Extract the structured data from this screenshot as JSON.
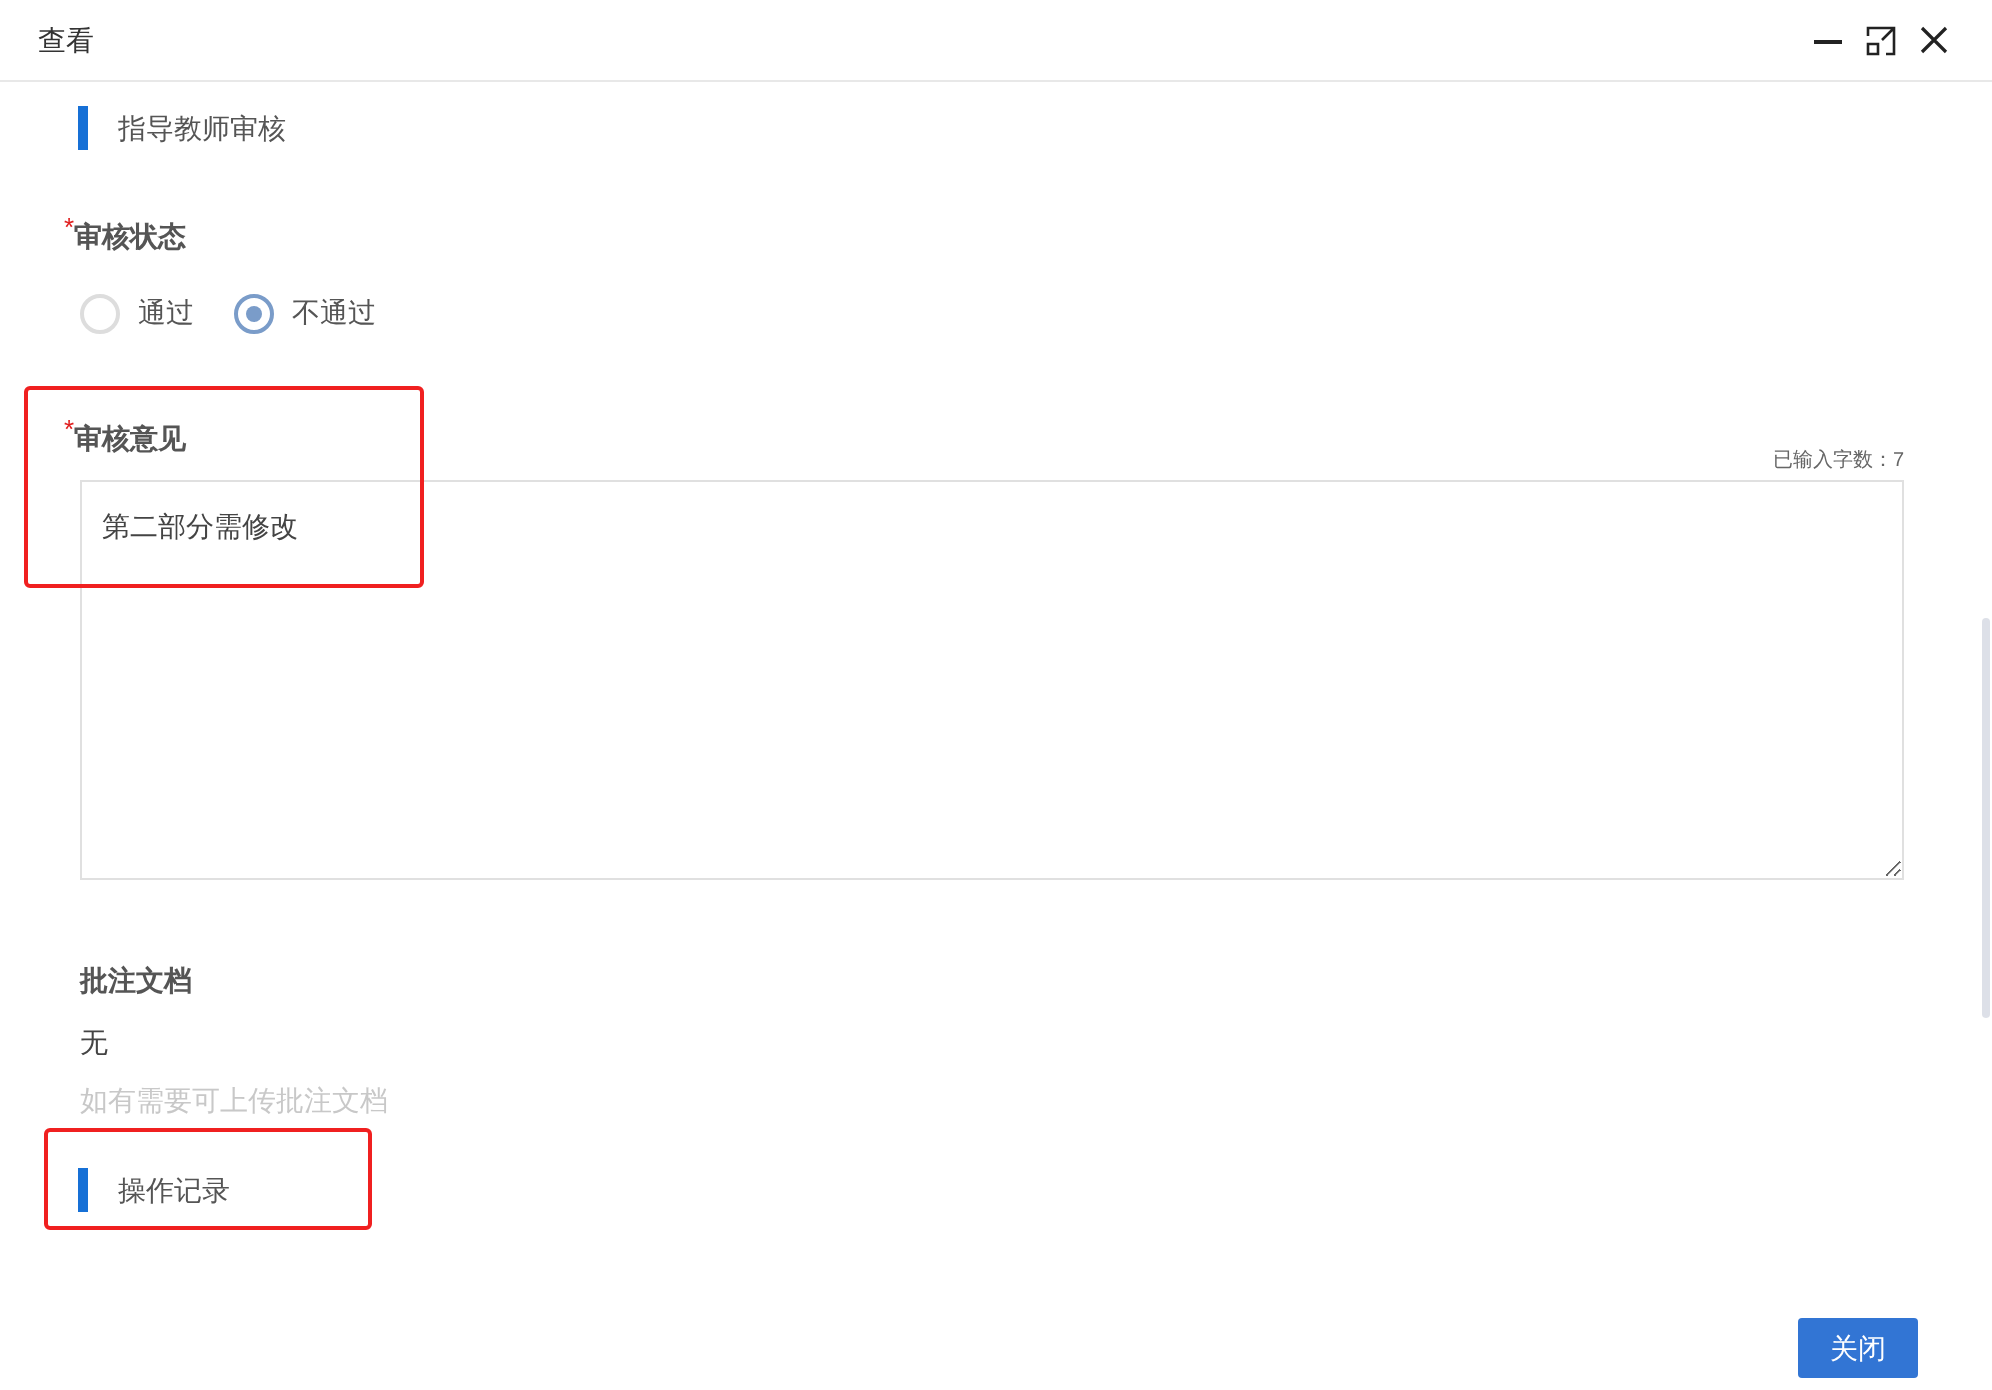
{
  "window": {
    "title": "查看"
  },
  "sections": [
    {
      "title": "指导教师审核"
    },
    {
      "title": "操作记录"
    }
  ],
  "review_status": {
    "label": "审核状态",
    "required_mark": "*",
    "options": [
      {
        "label": "通过",
        "selected": false
      },
      {
        "label": "不通过",
        "selected": true
      }
    ]
  },
  "review_comment": {
    "label": "审核意见",
    "required_mark": "*",
    "counter": "已输入字数：7",
    "value": "第二部分需修改"
  },
  "annotation_docs": {
    "label": "批注文档",
    "value": "无",
    "hint": "如有需要可上传批注文档"
  },
  "buttons": [
    "关闭"
  ]
}
